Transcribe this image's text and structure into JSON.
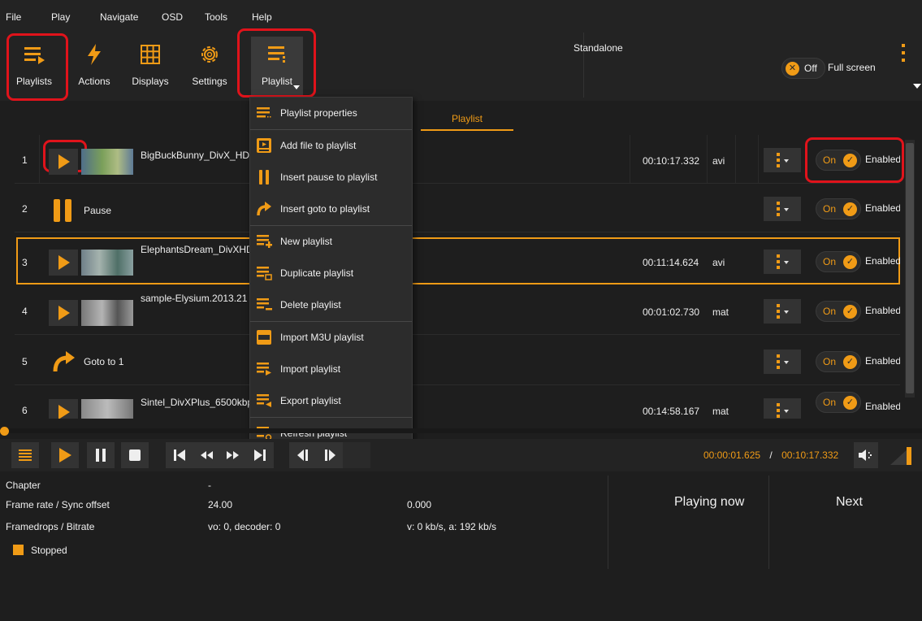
{
  "menubar": {
    "items": [
      "File",
      "Play",
      "Navigate",
      "OSD",
      "Tools",
      "Help"
    ]
  },
  "toolbar": {
    "playlists_label": "Playlists",
    "actions_label": "Actions",
    "displays_label": "Displays",
    "settings_label": "Settings",
    "playlist_label": "Playlist"
  },
  "topright": {
    "mode": "Standalone",
    "fullscreen_toggle": "Off",
    "fullscreen_label": "Full screen"
  },
  "tab": {
    "label": "Playlist"
  },
  "playlist": {
    "rows": [
      {
        "num": "1",
        "title": "BigBuckBunny_DivX_HD",
        "duration": "00:10:17.332",
        "ext": "avi",
        "toggle": "On",
        "status": "Enabled"
      },
      {
        "num": "2",
        "title": "Pause",
        "duration": "",
        "ext": "",
        "toggle": "On",
        "status": "Enabled"
      },
      {
        "num": "3",
        "title": "ElephantsDream_DivXHD",
        "duration": "00:11:14.624",
        "ext": "avi",
        "toggle": "On",
        "status": "Enabled"
      },
      {
        "num": "4",
        "title": "sample-Elysium.2013.21",
        "duration": "00:01:02.730",
        "ext": "mat",
        "toggle": "On",
        "status": "Enabled"
      },
      {
        "num": "5",
        "title": "Goto to 1",
        "duration": "",
        "ext": "",
        "toggle": "On",
        "status": "Enabled"
      },
      {
        "num": "6",
        "title": "Sintel_DivXPlus_6500kbp",
        "duration": "00:14:58.167",
        "ext": "mat",
        "toggle": "On",
        "status": "Enabled"
      }
    ]
  },
  "dropdown": {
    "items": [
      "Playlist properties",
      "Add file to playlist",
      "Insert pause to playlist",
      "Insert goto to playlist",
      "New playlist",
      "Duplicate playlist",
      "Delete playlist",
      "Import M3U playlist",
      "Import playlist",
      "Export playlist",
      "Refresh playlist"
    ]
  },
  "player": {
    "position": "00:00:01.625",
    "separator": "/",
    "duration": "00:10:17.332",
    "progress": 0.003
  },
  "info": {
    "chapter_label": "Chapter",
    "chapter_value": "-",
    "framerate_label": "Frame rate / Sync offset",
    "framerate_value": "24.00",
    "sync_value": "0.000",
    "framedrops_label": "Framedrops / Bitrate",
    "framedrops_value": "vo: 0, decoder: 0",
    "bitrate_value": "v: 0 kb/s, a: 192 kb/s",
    "status": "Stopped",
    "playing_now": "Playing now",
    "next": "Next"
  },
  "colors": {
    "accent": "#f09b16",
    "highlight_box": "#e0131b",
    "background": "#1e1e1e"
  }
}
